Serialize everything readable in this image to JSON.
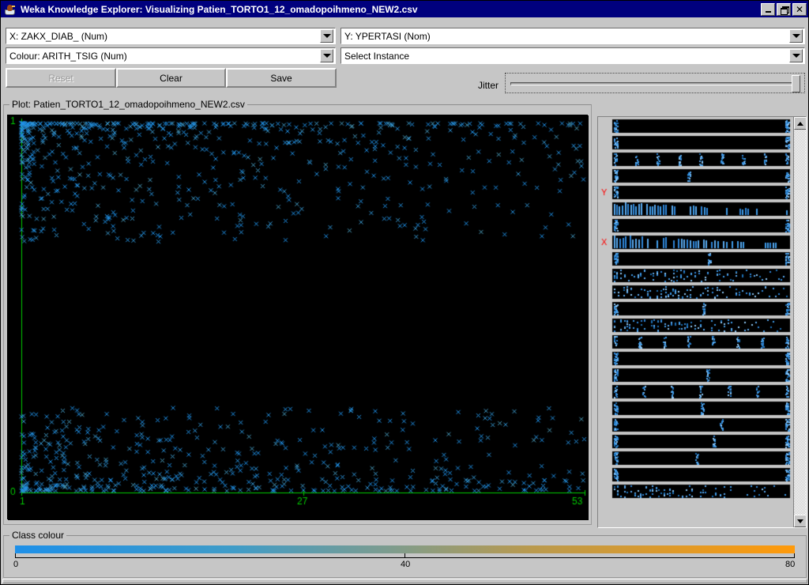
{
  "window": {
    "title": "Weka Knowledge Explorer: Visualizing Patien_TORTO1_12_omadopoihmeno_NEW2.csv",
    "icon": "weka-bird-icon",
    "minimize_label": "_",
    "restore_label": "▣",
    "close_label": "✕"
  },
  "selectors": {
    "x_axis": "X: ZAKX_DIAB_ (Num)",
    "y_axis": "Y: YPERTASI (Nom)",
    "colour": "Colour: ARITH_TSIG (Num)",
    "instance": "Select Instance",
    "dropdown_icon": "chevron-down-icon"
  },
  "buttons": {
    "reset": "Reset",
    "clear": "Clear",
    "save": "Save",
    "reset_enabled": false
  },
  "jitter": {
    "label": "Jitter",
    "value": 100,
    "min": 0,
    "max": 100
  },
  "plot": {
    "border_title": "Plot: Patien_TORTO1_12_omadopoihmeno_NEW2.csv",
    "background": "#000000",
    "axis_colour": "#00cc00"
  },
  "chart_data": {
    "type": "scatter",
    "title": "Plot: Patien_TORTO1_12_omadopoihmeno_NEW2.csv",
    "xlabel": "X: ZAKX_DIAB_ (Num)",
    "ylabel": "Y: YPERTASI (Nom)",
    "colour_by": "Colour: ARITH_TSIG (Num)",
    "xlim": [
      1,
      53
    ],
    "ylim": [
      0,
      1
    ],
    "x_ticks": [
      "1",
      "27",
      "53"
    ],
    "x_tick_values": [
      1,
      27,
      53
    ],
    "y_ticks": [
      "0",
      "1"
    ],
    "y_tick_values": [
      0,
      1
    ],
    "grid": false,
    "marker": "x-cross",
    "n_points": 1200,
    "series": [
      {
        "name": "YPERTASI = 1",
        "y_band": 1,
        "share": 0.56,
        "x_density": "dense 1-27, sparse 27-53"
      },
      {
        "name": "YPERTASI = 0",
        "y_band": 0,
        "share": 0.44,
        "x_density": "dense 1-30, sparse 30-53"
      }
    ],
    "point_colour_range": [
      "#1e90e8",
      "#ff9a0a"
    ]
  },
  "attributes": {
    "scrollbar": {
      "up_icon": "triangle-up-icon",
      "down_icon": "triangle-down-icon"
    },
    "y_marker": "Y",
    "x_marker": "X",
    "y_marker_row": 4,
    "x_marker_row": 7,
    "rows": [
      {
        "pattern": "edges"
      },
      {
        "pattern": "edges"
      },
      {
        "pattern": "spread"
      },
      {
        "pattern": "edges"
      },
      {
        "pattern": "edges"
      },
      {
        "pattern": "bars"
      },
      {
        "pattern": "edges"
      },
      {
        "pattern": "bars"
      },
      {
        "pattern": "edges"
      },
      {
        "pattern": "noise"
      },
      {
        "pattern": "noise"
      },
      {
        "pattern": "edges"
      },
      {
        "pattern": "noise"
      },
      {
        "pattern": "spread"
      },
      {
        "pattern": "edges"
      },
      {
        "pattern": "edges"
      },
      {
        "pattern": "spread"
      },
      {
        "pattern": "edges"
      },
      {
        "pattern": "edges"
      },
      {
        "pattern": "edges"
      },
      {
        "pattern": "edges"
      },
      {
        "pattern": "edges"
      },
      {
        "pattern": "noise"
      }
    ]
  },
  "class_colour": {
    "border_title": "Class colour",
    "gradient_start": "#1e90e8",
    "gradient_end": "#ff9a0a",
    "ticks": [
      "0",
      "40",
      "80"
    ],
    "tick_values": [
      0,
      40,
      80
    ],
    "min": 0,
    "max": 80
  }
}
